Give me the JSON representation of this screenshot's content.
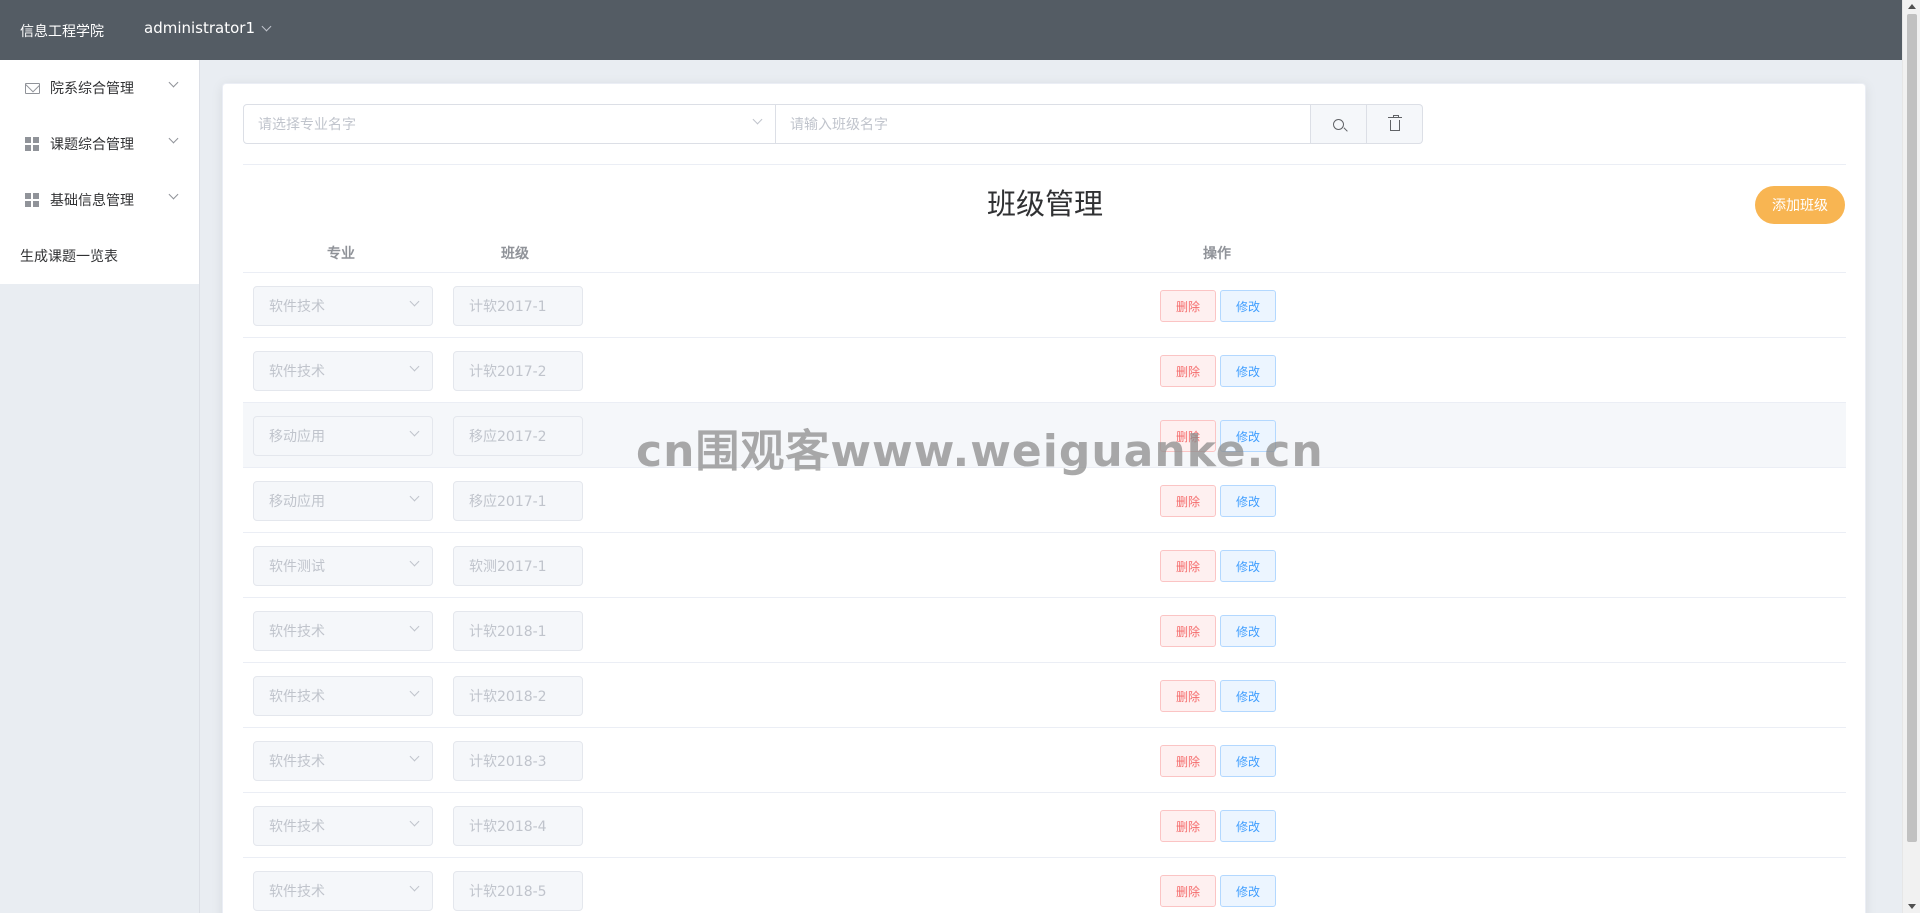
{
  "header": {
    "brand": "信息工程学院",
    "user": "administrator1"
  },
  "sidebar": {
    "items": [
      {
        "label": "院系综合管理",
        "icon": "mail-icon"
      },
      {
        "label": "课题综合管理",
        "icon": "grid-icon"
      },
      {
        "label": "基础信息管理",
        "icon": "grid-icon"
      },
      {
        "label": "生成课题一览表"
      }
    ]
  },
  "search": {
    "major_placeholder": "请选择专业名字",
    "class_placeholder": "请输入班级名字"
  },
  "page": {
    "title": "班级管理",
    "add_button": "添加班级"
  },
  "table": {
    "columns": [
      "专业",
      "班级",
      "操作"
    ],
    "delete_label": "删除",
    "edit_label": "修改",
    "rows": [
      {
        "major": "软件技术",
        "class": "计软2017-1"
      },
      {
        "major": "软件技术",
        "class": "计软2017-2"
      },
      {
        "major": "移动应用",
        "class": "移应2017-2"
      },
      {
        "major": "移动应用",
        "class": "移应2017-1"
      },
      {
        "major": "软件测试",
        "class": "软测2017-1"
      },
      {
        "major": "软件技术",
        "class": "计软2018-1"
      },
      {
        "major": "软件技术",
        "class": "计软2018-2"
      },
      {
        "major": "软件技术",
        "class": "计软2018-3"
      },
      {
        "major": "软件技术",
        "class": "计软2018-4"
      },
      {
        "major": "软件技术",
        "class": "计软2018-5"
      }
    ]
  },
  "watermark": "cn围观客www.weiguanke.cn",
  "colors": {
    "header_bg": "#545c64",
    "add_button": "#f8b552",
    "danger": "#f56c6c",
    "primary": "#409eff"
  }
}
